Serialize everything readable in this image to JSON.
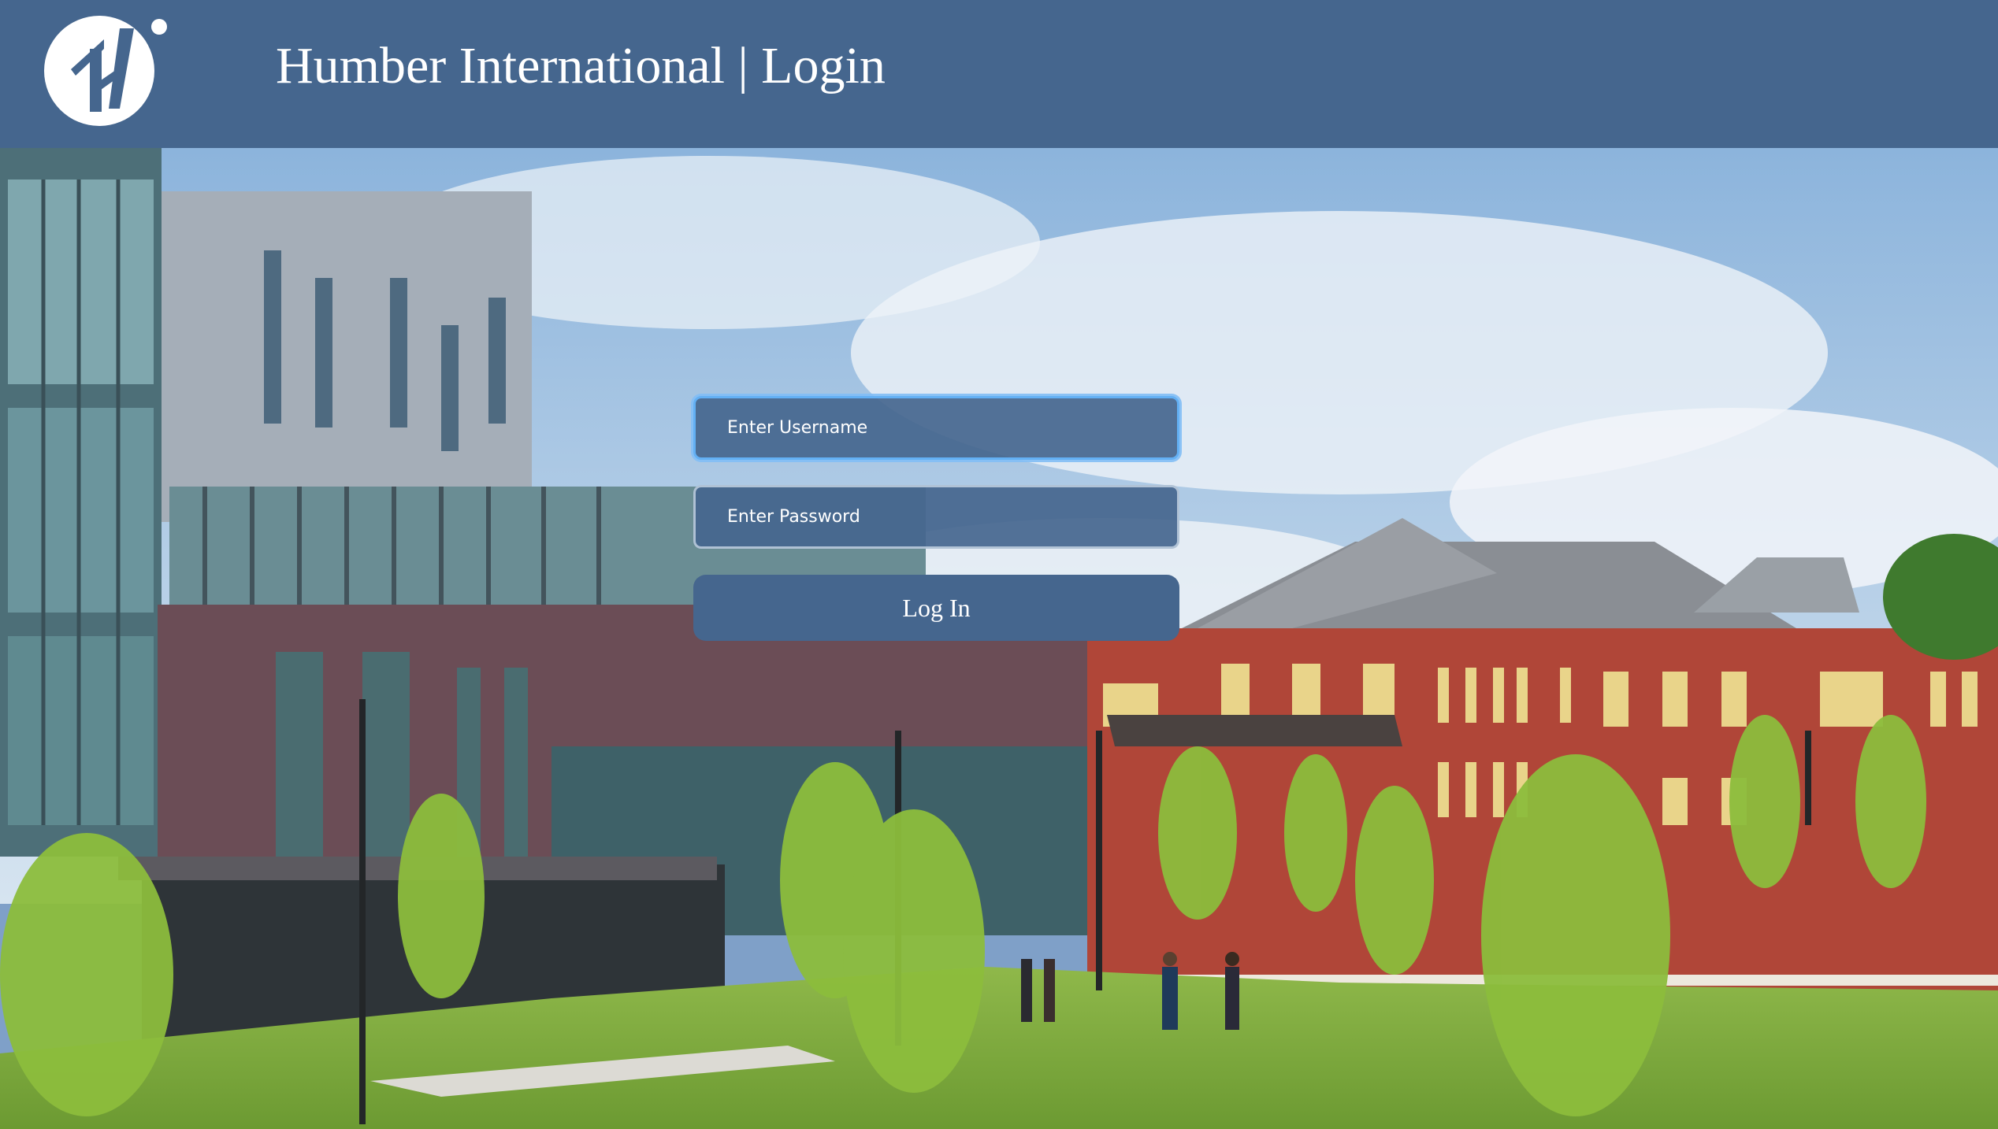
{
  "header": {
    "logo_icon": "humber-logo-icon",
    "title": "Humber International | Login"
  },
  "login": {
    "username_placeholder": "Enter Username",
    "password_placeholder": "Enter Password",
    "submit_label": "Log In"
  },
  "colors": {
    "header_bg": "#45668e",
    "field_bg": "#45668e",
    "focus_border": "#63b0f4"
  }
}
